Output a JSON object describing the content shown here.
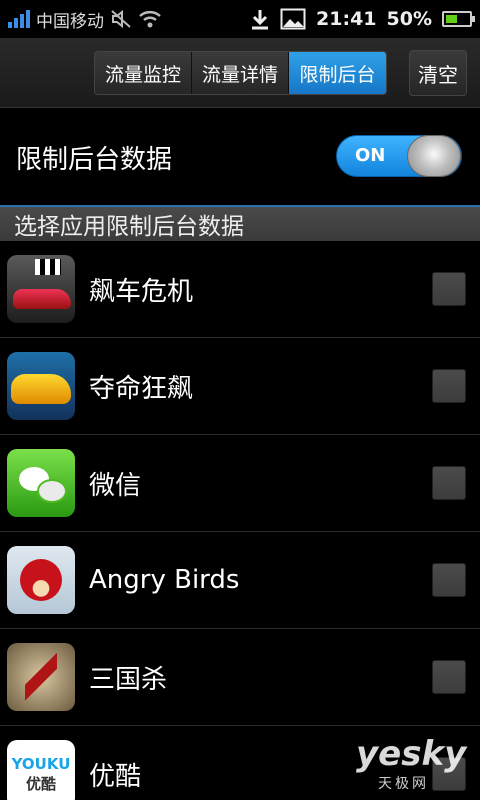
{
  "status_bar": {
    "carrier": "中国移动",
    "time": "21:41",
    "battery_percent": "50%",
    "battery_level": 0.5,
    "icons": [
      "signal-icon",
      "mute-icon",
      "wifi-icon",
      "download-icon",
      "image-icon",
      "battery-icon"
    ]
  },
  "tabs": [
    {
      "label": "流量监控",
      "active": false
    },
    {
      "label": "流量详情",
      "active": false
    },
    {
      "label": "限制后台",
      "active": true
    }
  ],
  "clear_button": {
    "label": "清空"
  },
  "restrict_toggle": {
    "label": "限制后台数据",
    "state": "ON"
  },
  "section": {
    "title": "选择应用限制后台数据"
  },
  "apps": [
    {
      "name": "飙车危机",
      "icon": "racing-game-icon",
      "checked": false
    },
    {
      "name": "夺命狂飙",
      "icon": "car-game-icon",
      "checked": false
    },
    {
      "name": "微信",
      "icon": "wechat-icon",
      "checked": false
    },
    {
      "name": "Angry Birds",
      "icon": "angry-birds-icon",
      "checked": false
    },
    {
      "name": "三国杀",
      "icon": "sanguosha-icon",
      "checked": false
    },
    {
      "name": "优酷",
      "icon": "youku-icon",
      "icon_text_top": "YOUKU",
      "icon_text_bottom": "优酷",
      "checked": false
    }
  ],
  "watermark": {
    "logo": "yesky",
    "subtitle": "天极网"
  },
  "colors": {
    "accent": "#1f8fe0",
    "background": "#000000",
    "battery": "#5fd016"
  }
}
